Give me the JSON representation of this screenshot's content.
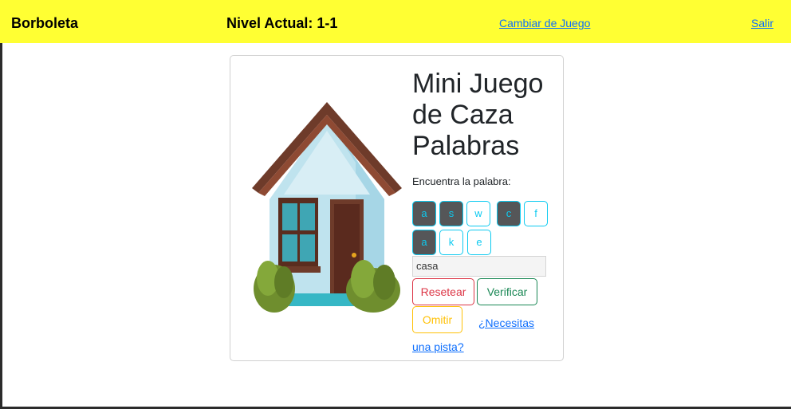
{
  "navbar": {
    "brand": "Borboleta",
    "level": "Nivel Actual: 1-1",
    "change_game": "Cambiar de Juego",
    "exit": "Salir",
    "background": "#ffff33"
  },
  "game": {
    "image_icon": "house-icon",
    "title": "Mini Juego de Caza Palabras",
    "prompt": "Encuentra la palabra:",
    "letters": [
      {
        "char": "a",
        "used": true
      },
      {
        "char": "s",
        "used": true
      },
      {
        "char": "w",
        "used": false
      },
      {
        "char": "c",
        "used": true
      },
      {
        "char": "f",
        "used": false
      },
      {
        "char": "a",
        "used": true
      },
      {
        "char": "k",
        "used": false
      },
      {
        "char": "e",
        "used": false
      }
    ],
    "answer_value": "casa",
    "buttons": {
      "reset": "Resetear",
      "verify": "Verificar",
      "skip": "Omitir"
    },
    "hint_link": "¿Necesitas una pista?"
  },
  "colors": {
    "info": "#0dcaf0",
    "danger": "#dc3545",
    "success": "#198754",
    "warning": "#ffc107",
    "link": "#0d6efd",
    "used_letter": "#555658"
  }
}
